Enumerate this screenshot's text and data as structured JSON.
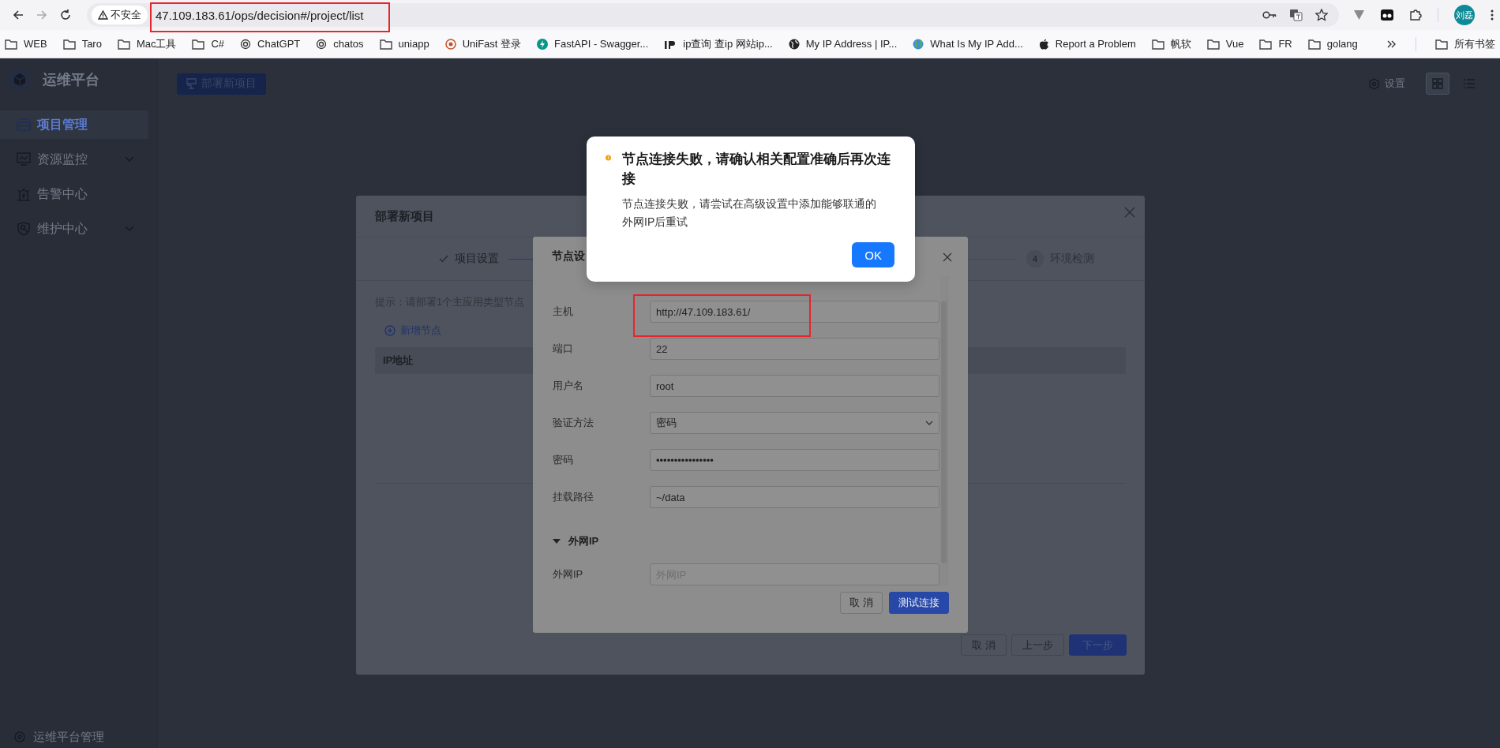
{
  "browser": {
    "security_label": "不安全",
    "url": "47.109.183.61/ops/decision#/project/list",
    "profile_label": "刘磊",
    "bookmarks": [
      {
        "kind": "folder",
        "label": "WEB"
      },
      {
        "kind": "folder",
        "label": "Taro"
      },
      {
        "kind": "folder",
        "label": "Mac工具"
      },
      {
        "kind": "folder",
        "label": "C#"
      },
      {
        "kind": "spiral",
        "label": "ChatGPT"
      },
      {
        "kind": "spiral",
        "label": "chatos"
      },
      {
        "kind": "folder",
        "label": "uniapp"
      },
      {
        "kind": "badge",
        "label": "UniFast 登录"
      },
      {
        "kind": "bolt",
        "label": "FastAPI - Swagger..."
      },
      {
        "kind": "ip",
        "label": "ip查询 查ip 网站ip..."
      },
      {
        "kind": "globe",
        "label": "My IP Address | IP..."
      },
      {
        "kind": "earth",
        "label": "What Is My IP Add..."
      },
      {
        "kind": "apple",
        "label": "Report a Problem"
      },
      {
        "kind": "folder",
        "label": "帆软"
      },
      {
        "kind": "folder",
        "label": "Vue"
      },
      {
        "kind": "folder",
        "label": "FR"
      },
      {
        "kind": "folder",
        "label": "golang"
      }
    ],
    "all_bookmarks": "所有书签"
  },
  "app": {
    "brand": "运维平台",
    "nav": [
      {
        "label": "项目管理",
        "kind": "item",
        "selected": true
      },
      {
        "label": "资源监控",
        "kind": "group",
        "selected": false
      },
      {
        "label": "告警中心",
        "kind": "item",
        "selected": false
      },
      {
        "label": "维护中心",
        "kind": "group",
        "selected": false
      }
    ],
    "footer": "运维平台管理",
    "deploy_button": "部署新项目",
    "settings": "设置",
    "views": [
      {
        "kind": "grid",
        "selected": true
      },
      {
        "kind": "list",
        "selected": false
      }
    ]
  },
  "deploy_dialog": {
    "title": "部署新项目",
    "steps": [
      {
        "kind": "done",
        "label": "项目设置"
      },
      {
        "kind": "waiting",
        "number": "4",
        "label": "环境检测"
      }
    ],
    "hint": "提示：请部署1个主应用类型节点",
    "add_node": "新增节点",
    "table": {
      "columns": [
        "IP地址"
      ]
    },
    "buttons": [
      {
        "label": "取 消",
        "kind": "default"
      },
      {
        "label": "上一步",
        "kind": "default"
      },
      {
        "label": "下一步",
        "kind": "primary"
      }
    ]
  },
  "node_dialog": {
    "title": "节点设",
    "fields": [
      {
        "label": "主机",
        "kind": "text",
        "value": "http://47.109.183.61/"
      },
      {
        "label": "端口",
        "kind": "text",
        "value": "22"
      },
      {
        "label": "用户名",
        "kind": "text",
        "value": "root"
      },
      {
        "label": "验证方法",
        "kind": "select",
        "value": "密码"
      },
      {
        "label": "密码",
        "kind": "password",
        "value": "••••••••••••••••"
      },
      {
        "label": "挂载路径",
        "kind": "text",
        "value": "~/data"
      }
    ],
    "section": {
      "label": "外网IP",
      "expanded": true,
      "fields": [
        {
          "label": "外网IP",
          "kind": "text",
          "placeholder": "外网IP"
        }
      ]
    },
    "buttons": [
      {
        "label": "取 消",
        "kind": "default"
      },
      {
        "label": "测试连接",
        "kind": "primary"
      }
    ]
  },
  "alert": {
    "title": "节点连接失败，请确认相关配置准确后再次连接",
    "message": "节点连接失败，请尝试在高级设置中添加能够联通的外网IP后重试",
    "ok_button": "OK"
  }
}
